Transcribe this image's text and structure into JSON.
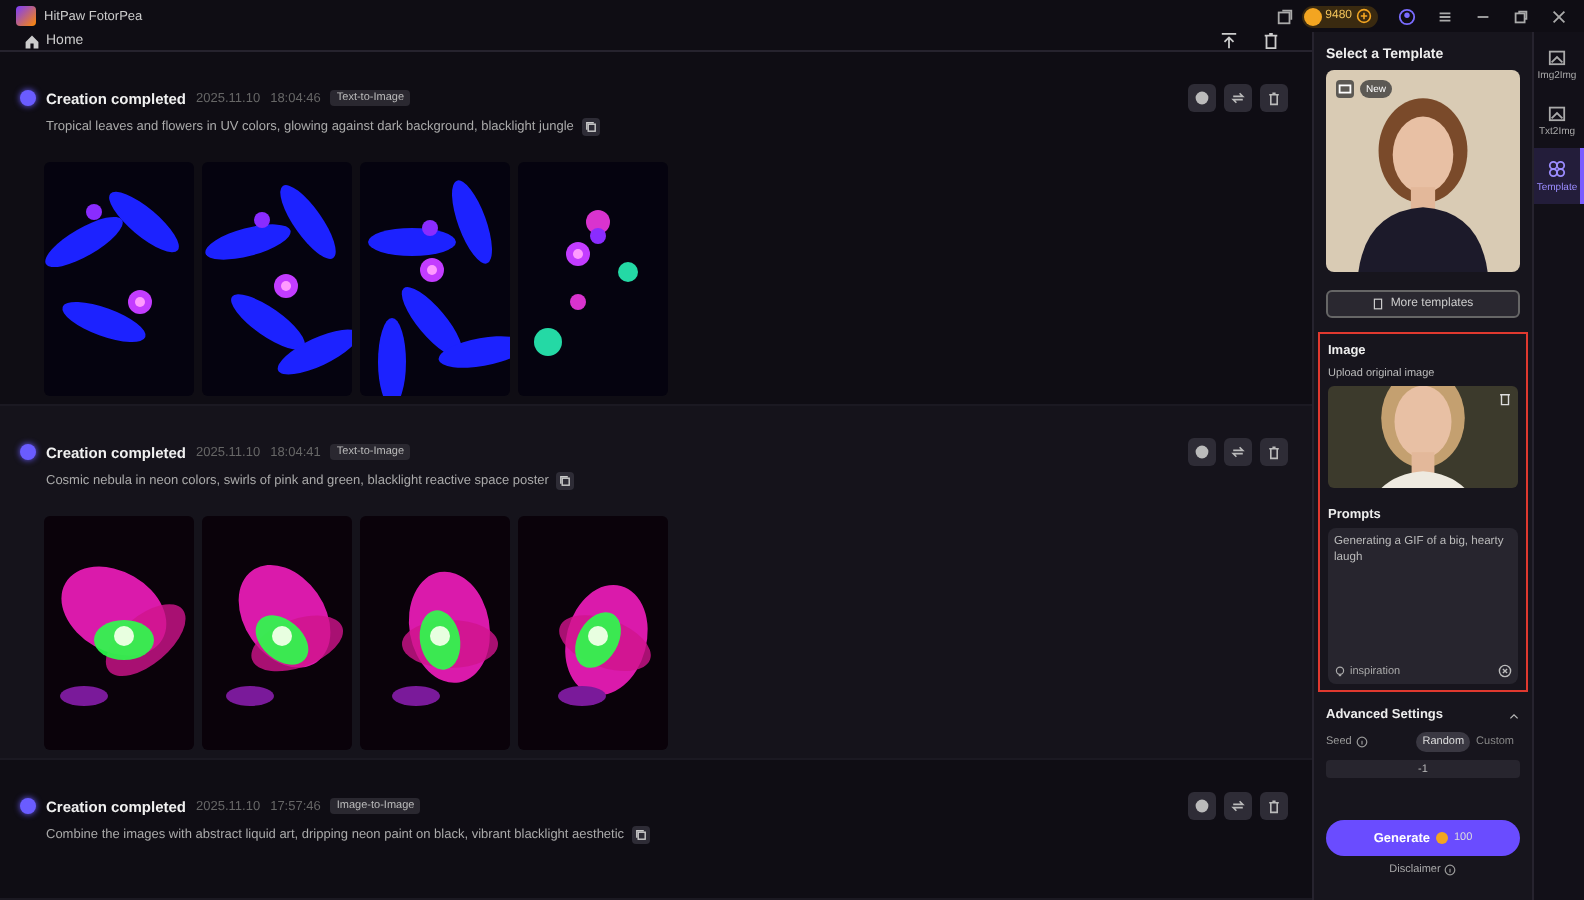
{
  "window": {
    "title": "HitPaw FotorPea",
    "credits": "9480"
  },
  "nav": {
    "home": "Home"
  },
  "creations": [
    {
      "status": "Creation completed",
      "date": "2025.11.10",
      "time": "18:04:46",
      "type": "Text-to-Image",
      "prompt": "Tropical leaves and flowers in UV colors, glowing against dark background, blacklight jungle"
    },
    {
      "status": "Creation completed",
      "date": "2025.11.10",
      "time": "18:04:41",
      "type": "Text-to-Image",
      "prompt": "Cosmic nebula in neon colors, swirls of pink and green, blacklight reactive space poster"
    },
    {
      "status": "Creation completed",
      "date": "2025.11.10",
      "time": "17:57:46",
      "type": "Image-to-Image",
      "prompt": "Combine the images with abstract liquid art, dripping neon paint on black, vibrant blacklight aesthetic"
    }
  ],
  "panel": {
    "title": "Select a Template",
    "template_badge": "New",
    "more_templates": "More templates",
    "image": {
      "title": "Image",
      "hint": "Upload original image"
    },
    "prompts": {
      "title": "Prompts",
      "value": "Generating a GIF of a big, hearty laugh",
      "inspiration": "inspiration"
    },
    "advanced": {
      "title": "Advanced Settings",
      "expanded": true,
      "seed_label": "Seed",
      "options": [
        {
          "label": "Random",
          "selected": true
        },
        {
          "label": "Custom",
          "selected": false
        }
      ],
      "seed_value": "-1"
    },
    "generate": {
      "label": "Generate",
      "cost": "100"
    },
    "disclaimer": "Disclaimer"
  },
  "rail": [
    {
      "label": "Img2Img",
      "selected": false
    },
    {
      "label": "Txt2Img",
      "selected": false
    },
    {
      "label": "Template",
      "selected": true
    }
  ]
}
